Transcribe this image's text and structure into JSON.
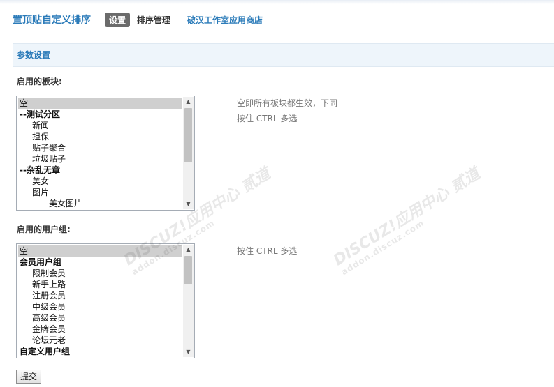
{
  "header": {
    "title": "置顶贴自定义排序",
    "tabs": [
      {
        "label": "设置",
        "active": true
      },
      {
        "label": "排序管理",
        "active": false
      }
    ],
    "store_link": "破汉工作室应用商店"
  },
  "section": {
    "title": "参数设置"
  },
  "forums": {
    "label": "启用的板块:",
    "options": [
      {
        "text": "空",
        "selected": true,
        "group": false,
        "indent": 0
      },
      {
        "text": "--测试分区",
        "selected": false,
        "group": true,
        "indent": 0
      },
      {
        "text": "新闻",
        "selected": false,
        "group": false,
        "indent": 1
      },
      {
        "text": "担保",
        "selected": false,
        "group": false,
        "indent": 1
      },
      {
        "text": "贴子聚合",
        "selected": false,
        "group": false,
        "indent": 1
      },
      {
        "text": "垃圾贴子",
        "selected": false,
        "group": false,
        "indent": 1
      },
      {
        "text": "--杂乱无章",
        "selected": false,
        "group": true,
        "indent": 0
      },
      {
        "text": "美女",
        "selected": false,
        "group": false,
        "indent": 1
      },
      {
        "text": "图片",
        "selected": false,
        "group": false,
        "indent": 1
      },
      {
        "text": "美女图片",
        "selected": false,
        "group": false,
        "indent": 2
      }
    ],
    "scroll_fraction": 0.58,
    "hint_lines": [
      "空即所有板块都生效，下同",
      "按住 CTRL 多选"
    ]
  },
  "groups": {
    "label": "启用的用户组:",
    "options": [
      {
        "text": "空",
        "selected": true,
        "group": false,
        "indent": 0
      },
      {
        "text": "会员用户组",
        "selected": false,
        "group": true,
        "indent": 0
      },
      {
        "text": "限制会员",
        "selected": false,
        "group": false,
        "indent": 1
      },
      {
        "text": "新手上路",
        "selected": false,
        "group": false,
        "indent": 1
      },
      {
        "text": "注册会员",
        "selected": false,
        "group": false,
        "indent": 1
      },
      {
        "text": "中级会员",
        "selected": false,
        "group": false,
        "indent": 1
      },
      {
        "text": "高级会员",
        "selected": false,
        "group": false,
        "indent": 1
      },
      {
        "text": "金牌会员",
        "selected": false,
        "group": false,
        "indent": 1
      },
      {
        "text": "论坛元老",
        "selected": false,
        "group": false,
        "indent": 1
      },
      {
        "text": "自定义用户组",
        "selected": false,
        "group": true,
        "indent": 0
      }
    ],
    "scroll_fraction": 0.3,
    "hint_lines": [
      "按住 CTRL 多选"
    ]
  },
  "submit_label": "提交",
  "watermark": {
    "brand": "DISCUZ!应用中心",
    "site": "addon.discuz.com",
    "mark": "贰道"
  },
  "colors": {
    "accent": "#2b7bb9",
    "section_bg": "#eef5fb",
    "active_tab": "#6b6b6b"
  }
}
